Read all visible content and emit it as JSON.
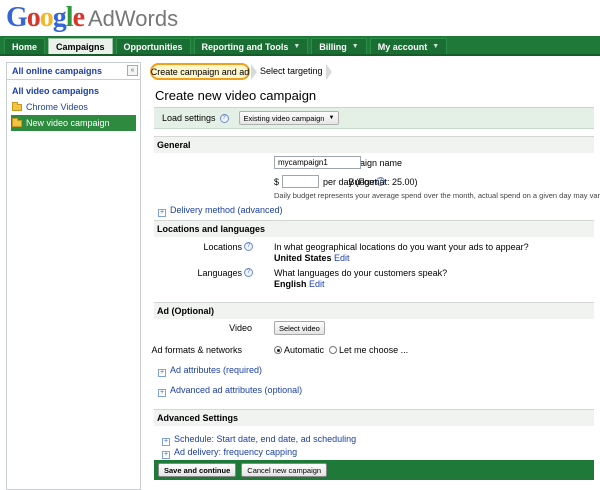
{
  "header": {
    "logo_google": "Google",
    "logo_product": "AdWords"
  },
  "nav": {
    "tabs": [
      {
        "label": "Home",
        "caret": false,
        "active": false
      },
      {
        "label": "Campaigns",
        "caret": false,
        "active": true
      },
      {
        "label": "Opportunities",
        "caret": false,
        "active": false
      },
      {
        "label": "Reporting and Tools",
        "caret": true,
        "active": false
      },
      {
        "label": "Billing",
        "caret": true,
        "active": false
      },
      {
        "label": "My account",
        "caret": true,
        "active": false
      }
    ]
  },
  "sidebar": {
    "header": "All online campaigns",
    "collapse_glyph": "«",
    "group": "All video campaigns",
    "items": [
      {
        "label": "Chrome Videos",
        "selected": false
      },
      {
        "label": "New video campaign",
        "selected": true
      }
    ]
  },
  "breadcrumb": {
    "step1": "Create campaign and ad",
    "step2": "Select targeting"
  },
  "page": {
    "title": "Create new video campaign",
    "load_settings_label": "Load settings",
    "load_settings_value": "Existing video campaign",
    "help_glyph": "?",
    "plus_glyph": "+"
  },
  "general": {
    "heading": "General",
    "campaign_name_label": "Campaign name",
    "campaign_name_value": "mycampaign1",
    "budget_label": "Budget",
    "budget_currency": "$",
    "budget_value": "",
    "budget_suffix": "per day (Format: 25.00)",
    "budget_note": "Daily budget represents your average spend over the month, actual spend on a given day may vary.",
    "delivery_method": "Delivery method (advanced)"
  },
  "locations": {
    "heading": "Locations and languages",
    "locations_label": "Locations",
    "locations_question": "In what geographical locations do you want your ads to appear?",
    "locations_value": "United States",
    "languages_label": "Languages",
    "languages_question": "What languages do your customers speak?",
    "languages_value": "English",
    "edit": "Edit"
  },
  "ad": {
    "heading": "Ad (Optional)",
    "video_label": "Video",
    "select_video": "Select video",
    "formats_label": "Ad formats & networks",
    "option_automatic": "Automatic",
    "option_manual": "Let me choose ...",
    "selected_option": "automatic",
    "ad_attributes": "Ad attributes (required)",
    "advanced_attributes": "Advanced ad attributes (optional)"
  },
  "advanced": {
    "heading": "Advanced Settings",
    "schedule": "Schedule: Start date, end date, ad scheduling",
    "delivery": "Ad delivery: frequency capping"
  },
  "footer": {
    "save": "Save and continue",
    "cancel": "Cancel new campaign"
  }
}
